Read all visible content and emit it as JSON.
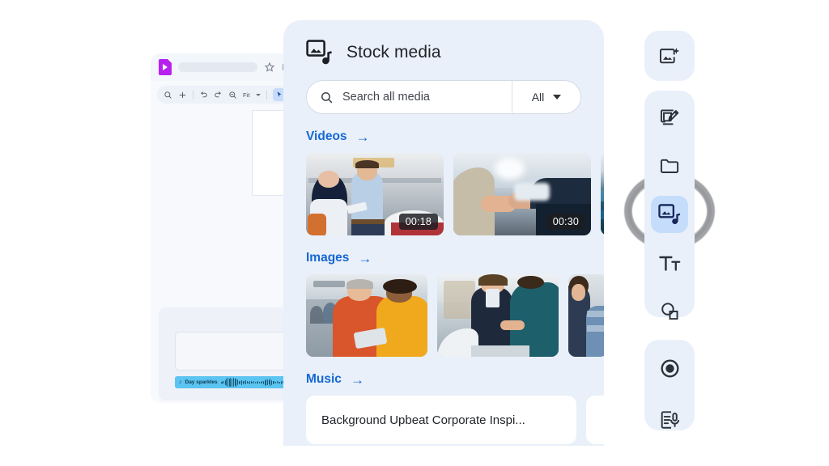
{
  "editor": {
    "app_logo": "google-vids-logo",
    "title_placeholder": "",
    "titlebar_icons": [
      "star-icon",
      "move-to-folder-icon"
    ],
    "toolbar": {
      "items": [
        "zoom-icon",
        "plus-icon",
        "undo-icon",
        "redo-icon",
        "zoom-out-icon"
      ],
      "fit_label": "Fit",
      "cursor_icon": "pointer-icon",
      "align_icon": "align-icon"
    },
    "timeline": {
      "audio_clip_name": "Day sparkles",
      "audio_note_icon": "music-note-icon"
    }
  },
  "panel": {
    "header_icon": "stock-media-icon",
    "title": "Stock media",
    "search": {
      "icon": "search-icon",
      "placeholder": "Search all media",
      "filter_label": "All",
      "filter_icon": "chevron-down-icon"
    },
    "sections": [
      {
        "title": "Videos",
        "arrow": "→",
        "items": [
          {
            "alt": "Two colleagues talking with tablet in car showroom",
            "duration": "00:18"
          },
          {
            "alt": "Handshake in front of a car in a dealership",
            "duration": "00:30"
          },
          {
            "alt": "Third video thumbnail partially visible",
            "duration": ""
          }
        ]
      },
      {
        "title": "Images",
        "arrow": "→",
        "items": [
          {
            "alt": "Man in orange sweater and woman in yellow sweater with tablet in office"
          },
          {
            "alt": "Businesswoman shaking hands across a table with colleague"
          },
          {
            "alt": "Third image thumbnail partially visible"
          }
        ]
      },
      {
        "title": "Music",
        "arrow": "→",
        "items": [
          {
            "name": "Background Upbeat Corporate Inspi..."
          },
          {
            "name": ""
          }
        ]
      }
    ]
  },
  "rail": {
    "groups": [
      {
        "buttons": [
          {
            "icon": "generate-image-icon",
            "active": false
          }
        ]
      },
      {
        "buttons": [
          {
            "icon": "draw-edit-icon",
            "active": false
          },
          {
            "icon": "folder-icon",
            "active": false
          },
          {
            "icon": "stock-media-icon",
            "active": true
          },
          {
            "icon": "text-icon",
            "active": false
          },
          {
            "icon": "shapes-icon",
            "active": false
          }
        ]
      },
      {
        "buttons": [
          {
            "icon": "record-icon",
            "active": false
          },
          {
            "icon": "script-voiceover-icon",
            "active": false
          }
        ]
      }
    ],
    "highlight_annotation": "grey-ring-highlight"
  },
  "colors": {
    "panel_bg": "#e9f0f9",
    "rail_bg": "#e9f0fa",
    "accent_link": "#1567d3",
    "active_btn": "#c5ddfb",
    "audio_clip": "#5bc4f1",
    "logo_purple": "#b721f0"
  }
}
